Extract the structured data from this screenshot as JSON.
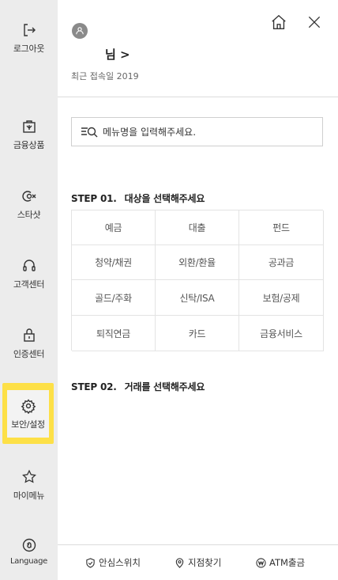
{
  "sidebar": {
    "items": [
      {
        "label": "로그아웃",
        "icon": "logout-icon"
      },
      {
        "label": "금융상품",
        "icon": "bag-icon"
      },
      {
        "label": "스타샷",
        "icon": "starshot-icon"
      },
      {
        "label": "고객센터",
        "icon": "headset-icon"
      },
      {
        "label": "인증센터",
        "icon": "lock-icon"
      },
      {
        "label": "보안/설정",
        "icon": "gear-icon",
        "active": true
      },
      {
        "label": "마이메뉴",
        "icon": "star-icon"
      },
      {
        "label": "Language",
        "icon": "language-icon"
      }
    ]
  },
  "header": {
    "user_name": "님 >",
    "last_login": "최근 접속일 2019"
  },
  "search": {
    "placeholder": "메뉴명을 입력해주세요."
  },
  "step1": {
    "num": "STEP 01.",
    "title": "대상을 선택해주세요",
    "categories": [
      "예금",
      "대출",
      "펀드",
      "청약/채권",
      "외환/환율",
      "공과금",
      "골드/주화",
      "신탁/ISA",
      "보험/공제",
      "퇴직연금",
      "카드",
      "금융서비스"
    ]
  },
  "step2": {
    "num": "STEP 02.",
    "title": "거래를 선택해주세요"
  },
  "footer": {
    "items": [
      {
        "label": "안심스위치",
        "icon": "shield-check-icon"
      },
      {
        "label": "지점찾기",
        "icon": "location-pin-icon"
      },
      {
        "label": "ATM출금",
        "icon": "won-icon"
      }
    ]
  },
  "colors": {
    "sidebar_bg": "#ececec",
    "highlight": "#fde047",
    "border": "#dcdcdc"
  }
}
